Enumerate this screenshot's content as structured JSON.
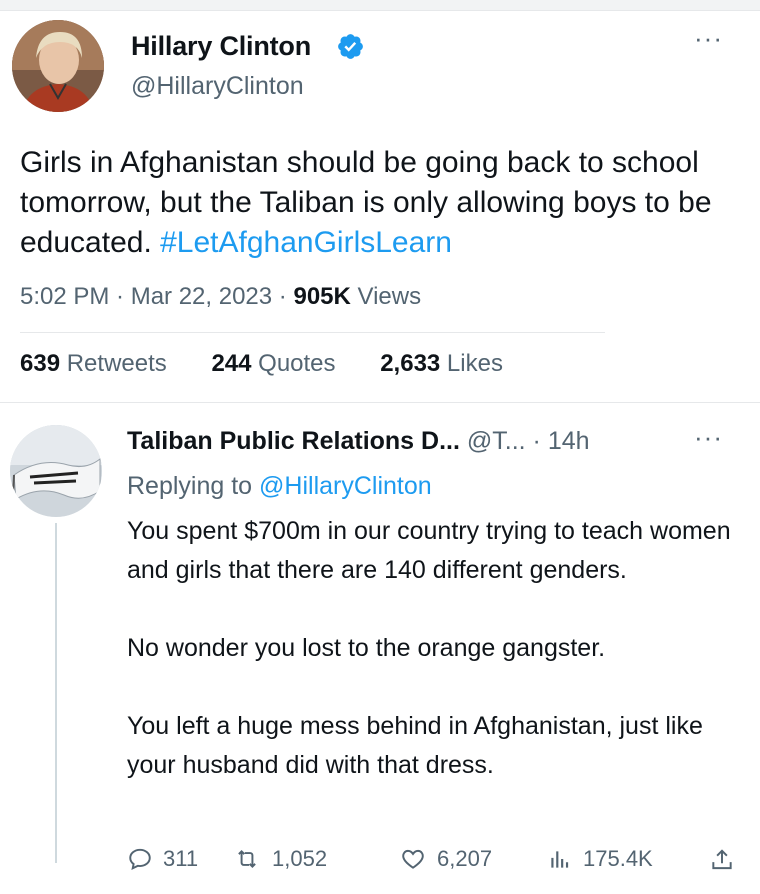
{
  "tweet": {
    "author_name": "Hillary Clinton",
    "author_handle": "@HillaryClinton",
    "text_plain": "Girls in Afghanistan should be going back to school tomorrow, but the Taliban is only allowing boys to be educated. ",
    "hashtag": "#LetAfghanGirlsLearn",
    "timestamp": "5:02 PM · Mar 22, 2023 · ",
    "views_count": "905K",
    "views_label": " Views",
    "stats": [
      {
        "value": "639",
        "label": " Retweets"
      },
      {
        "value": "244",
        "label": " Quotes"
      },
      {
        "value": "2,633",
        "label": " Likes"
      }
    ],
    "more": "···"
  },
  "reply": {
    "author_name": "Taliban Public Relations D...",
    "meta": " @T... · 14h",
    "replying_prefix": "Replying to ",
    "replying_to": "@HillaryClinton",
    "paragraphs": [
      "You spent $700m in our country trying to teach women and girls that there are 140 different genders.",
      "No wonder you lost to the orange gangster.",
      "You left a huge mess behind in Afghanistan, just like your husband did with that dress."
    ],
    "more": "···",
    "actions": {
      "replies": "311",
      "retweets": "1,052",
      "likes": "6,207",
      "views": "175.4K"
    }
  },
  "colors": {
    "accent": "#1d9bf0",
    "secondary_text": "#536471",
    "primary_text": "#0f1419"
  },
  "icons": [
    "verified-badge-icon",
    "more-icon",
    "reply-icon",
    "retweet-icon",
    "like-icon",
    "views-icon",
    "share-icon"
  ]
}
